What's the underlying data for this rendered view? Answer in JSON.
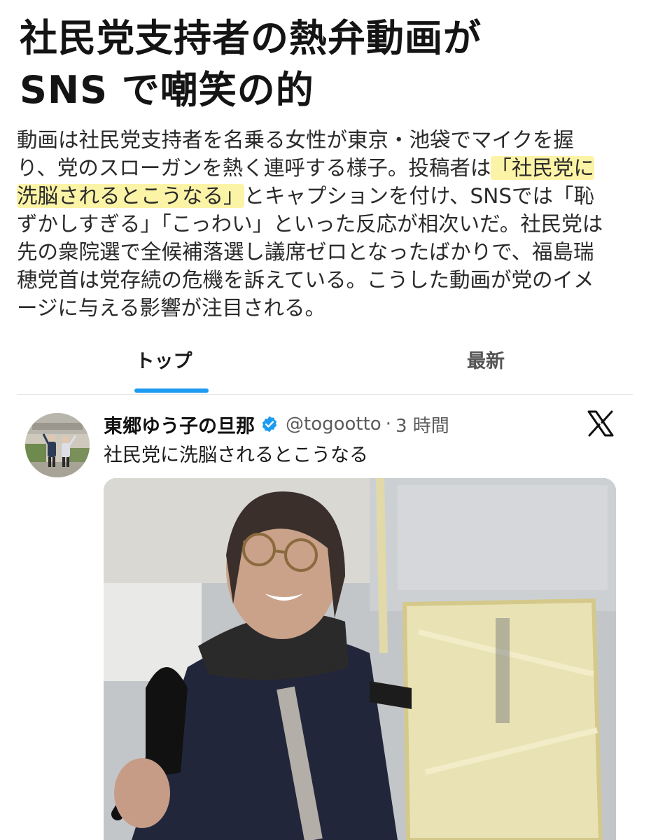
{
  "article": {
    "headline": [
      "社民党支持者の熱弁動画が",
      "SNS で嘲笑の的"
    ],
    "summary": {
      "line1": "動画は社民党支持者を名乗る女性が東京・池袋でマイクを握",
      "line2_pre": "り、党のスローガンを熱く連呼する様子。投稿者は",
      "line2_hl": "「社民党に",
      "line3_hl": "洗脳されるとこうなる」",
      "line3_post": "とキャプションを付け、SNSでは「恥",
      "line4": "ずかしすぎる」「こっわい」といった反応が相次いだ。社民党は",
      "line5": "先の衆院選で全候補落選し議席ゼロとなったばかりで、福島瑞",
      "line6": "穂党首は党存続の危機を訴えている。こうした動画が党のイメ",
      "line7": "ージに与える影響が注目される。"
    }
  },
  "tabs": [
    {
      "label": "トップ",
      "active": true
    },
    {
      "label": "最新",
      "active": false
    }
  ],
  "tweet": {
    "author": "東郷ゆう子の旦那",
    "verified": true,
    "handle": "@togootto",
    "separator": "·",
    "time": "3 時間",
    "text": "社民党に洗脳されるとこうなる",
    "platform_icon": "x-logo-icon"
  },
  "colors": {
    "accent": "#1d9bf0",
    "highlight": "#fbf3a6",
    "verified": "#1d9bf0"
  }
}
